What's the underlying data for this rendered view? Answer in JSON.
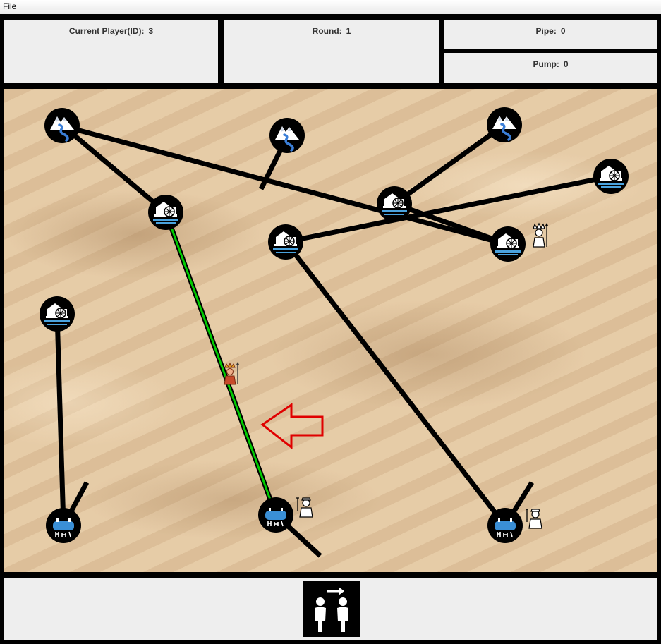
{
  "menu": {
    "file_label": "File"
  },
  "status": {
    "current_player_label": "Current Player(ID):",
    "current_player_value": "3",
    "round_label": "Round:",
    "round_value": "1",
    "pipe_label": "Pipe:",
    "pipe_value": "0",
    "pump_label": "Pump:",
    "pump_value": "0"
  },
  "board": {
    "nodes": [
      {
        "id": "spring-1",
        "type": "spring"
      },
      {
        "id": "spring-2",
        "type": "spring"
      },
      {
        "id": "spring-3",
        "type": "spring"
      },
      {
        "id": "pump-1",
        "type": "pump"
      },
      {
        "id": "pump-2",
        "type": "pump"
      },
      {
        "id": "pump-3",
        "type": "pump"
      },
      {
        "id": "pump-4",
        "type": "pump"
      },
      {
        "id": "pump-5",
        "type": "pump"
      },
      {
        "id": "pump-6",
        "type": "pump"
      },
      {
        "id": "cistern-1",
        "type": "cistern"
      },
      {
        "id": "cistern-2",
        "type": "cistern"
      },
      {
        "id": "cistern-3",
        "type": "cistern"
      }
    ],
    "pipes": [
      {
        "from": "spring-1",
        "to": "pump-5",
        "selected": false
      },
      {
        "from": "spring-1",
        "to": "pump-1",
        "selected": false
      },
      {
        "from": "spring-2",
        "to": "dangling",
        "selected": false
      },
      {
        "from": "spring-3",
        "to": "pump-4",
        "selected": false
      },
      {
        "from": "pump-2",
        "to": "pump-3",
        "selected": false
      },
      {
        "from": "pump-4",
        "to": "pump-5",
        "selected": false
      },
      {
        "from": "pump-3",
        "to": "cistern-3",
        "selected": false
      },
      {
        "from": "pump-6",
        "to": "cistern-1",
        "selected": false
      },
      {
        "from": "pump-1",
        "to": "cistern-2",
        "selected": true
      },
      {
        "from": "cistern-1",
        "to": "dangling",
        "selected": false
      },
      {
        "from": "cistern-2",
        "to": "dangling",
        "selected": false
      },
      {
        "from": "cistern-3",
        "to": "dangling",
        "selected": false
      }
    ],
    "players": [
      {
        "role": "saboteur",
        "location": "pump-5"
      },
      {
        "role": "saboteur",
        "location": "pipe pump-1 to cistern-2"
      },
      {
        "role": "plumber",
        "location": "cistern-2"
      },
      {
        "role": "plumber",
        "location": "cistern-3"
      }
    ],
    "highlight_color": "#00cc00",
    "arrow_color": "#e00000",
    "arrow_icon": "left-arrow-icon"
  },
  "actions": {
    "swap_player_icon": "swap-player-icon"
  }
}
